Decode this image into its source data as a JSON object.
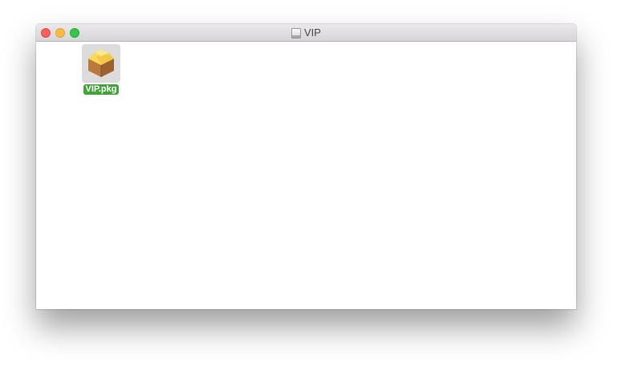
{
  "window": {
    "title": "VIP",
    "title_icon": "disk-icon"
  },
  "files": [
    {
      "name": "VIP.pkg",
      "icon": "package-icon",
      "selected": true
    }
  ],
  "colors": {
    "close": "#fc605c",
    "minimize": "#fdbc40",
    "zoom": "#34c84a",
    "selection_label": "#42a43a"
  }
}
